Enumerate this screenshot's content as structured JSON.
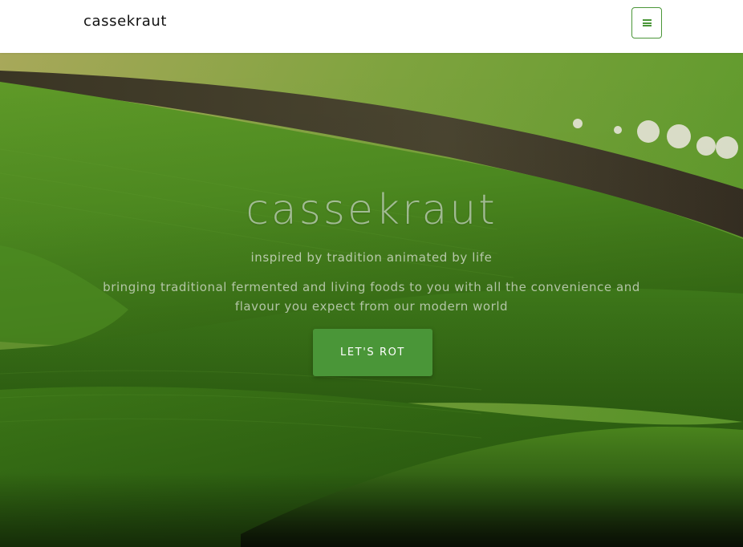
{
  "navbar": {
    "brand": "cassekraut",
    "menu_icon": "hamburger-icon",
    "accent_color": "#4a9638"
  },
  "hero": {
    "title": "cassekraut",
    "tagline": "inspired by tradition animated by life",
    "description": "bringing traditional fermented and living foods to you with all the convenience and flavour you expect from our modern world",
    "cta_label": "LET'S ROT",
    "cta_color": "#4a9638",
    "background_image": "rolling green fields landscape"
  }
}
